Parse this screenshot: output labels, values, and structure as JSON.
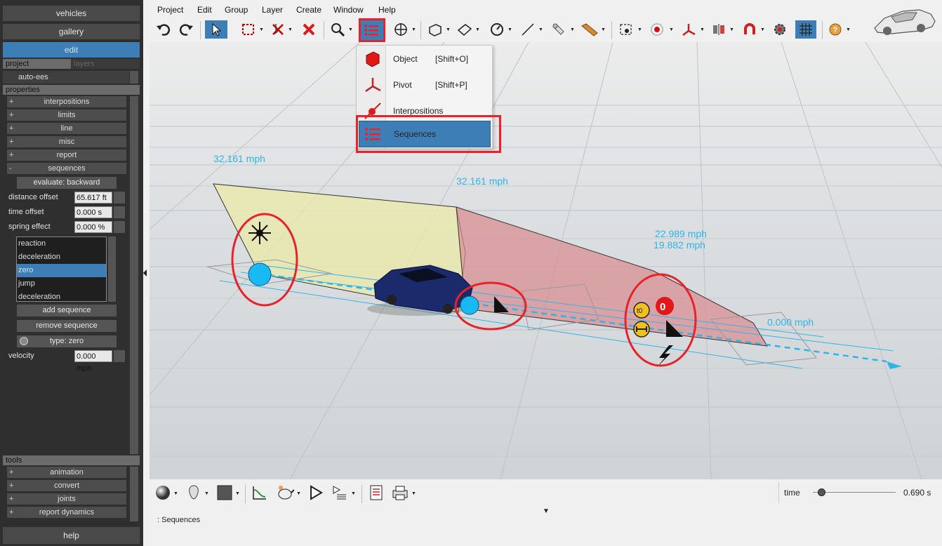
{
  "left_panel": {
    "nav": {
      "vehicles": "vehicles",
      "gallery": "gallery",
      "edit": "edit"
    },
    "tabs": {
      "project": "project",
      "layers": "layers"
    },
    "project_item": "auto-ees",
    "properties_header": "properties",
    "groups": {
      "interpositions": "interpositions",
      "limits": "limits",
      "line": "line",
      "misc": "misc",
      "report": "report",
      "sequences": "sequences"
    },
    "evaluate_button": "evaluate: backward",
    "props": {
      "distance_offset": {
        "label": "distance offset",
        "value": "65.617 ft"
      },
      "time_offset": {
        "label": "time offset",
        "value": "0.000 s"
      },
      "spring_effect": {
        "label": "spring effect",
        "value": "0.000 %"
      },
      "velocity": {
        "label": "velocity",
        "value": "0.000 mph"
      }
    },
    "sequence_list": [
      "reaction",
      "deceleration",
      "zero",
      "jump",
      "deceleration"
    ],
    "sequence_selected_index": 2,
    "add_sequence": "add sequence",
    "remove_sequence": "remove sequence",
    "type_label": "type: zero",
    "tools_header": "tools",
    "tools": {
      "animation": "animation",
      "convert": "convert",
      "joints": "joints",
      "report_dynamics": "report dynamics"
    },
    "help": "help",
    "plus": "+",
    "minus": "-"
  },
  "menu": {
    "project": "Project",
    "edit": "Edit",
    "group": "Group",
    "layer": "Layer",
    "create": "Create",
    "window": "Window",
    "help": "Help"
  },
  "popup_menu": {
    "object": {
      "label": "Object",
      "shortcut": "[Shift+O]"
    },
    "pivot": {
      "label": "Pivot",
      "shortcut": "[Shift+P]"
    },
    "interpositions": {
      "label": "Interpositions"
    },
    "sequences": {
      "label": "Sequences"
    }
  },
  "viewport": {
    "speed_labels": {
      "a": "32.161 mph",
      "b": "32.161 mph",
      "c": "22.989 mph",
      "d": "19.882 mph",
      "e": "0.000 mph"
    },
    "zero_marker": "0",
    "t0_marker": "t0"
  },
  "timeline": {
    "time_label": "time",
    "time_value": "0.690 s",
    "position_fraction": 0.1
  },
  "status": {
    "text": ": Sequences"
  },
  "colors": {
    "accent": "#3d7eb7",
    "highlight_red": "#e8212a",
    "speed_label": "#30b4e8"
  }
}
